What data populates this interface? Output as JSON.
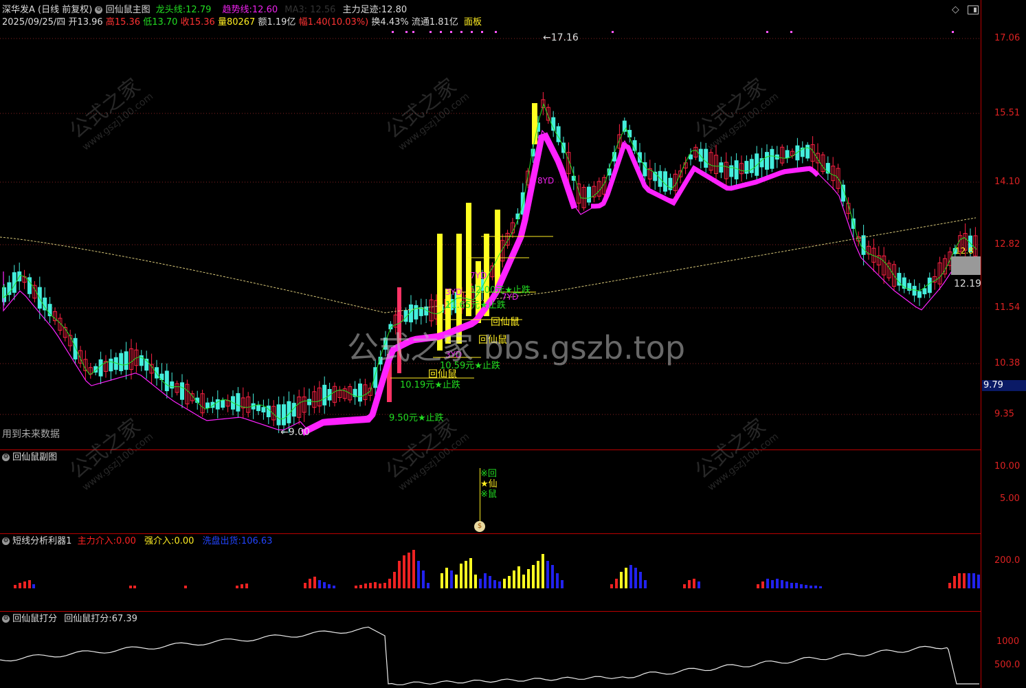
{
  "main": {
    "stock_name": "深华发A",
    "period": "(日线 前复权)",
    "indicator_name": "回仙鼠主图",
    "dragon_line_label": "龙头线:",
    "dragon_line_value": "12.79",
    "trend_line_label": "趋势线:",
    "trend_line_value": "12.60",
    "hidden_item": "MA3: 12.56",
    "footprint_label": "主力足迹:",
    "footprint_value": "12.80",
    "date": "2025/09/25/四",
    "open_label": "开",
    "open_value": "13.96",
    "high_label": "高",
    "high_value": "15.36",
    "low_label": "低",
    "low_value": "13.70",
    "close_label": "收",
    "close_value": "15.36",
    "vol_label": "量",
    "vol_value": "80267",
    "amt_label": "额",
    "amt_value": "1.19亿",
    "change_label": "幅",
    "change_value": "1.40(10.03%)",
    "turnover_label": "换",
    "turnover_value": "4.43%",
    "float_label": "流通",
    "float_value": "1.81亿",
    "board_label": "面板",
    "future_data": "用到未来数据",
    "axis": [
      "17.06",
      "15.51",
      "14.10",
      "12.82",
      "11.54",
      "10.38",
      "9.35"
    ],
    "price_tag": "9.79",
    "high_mark": "17.16",
    "low_mark": "9.00",
    "last_mark": "12.19",
    "right_mark": "12.8",
    "annotations": [
      {
        "text": "9.50元★止跌",
        "color": "#22dd22"
      },
      {
        "text": "10.19元★止跌",
        "color": "#22dd22"
      },
      {
        "text": "回仙鼠",
        "color": "#ffee22"
      },
      {
        "text": "10.59元★止跌",
        "color": "#22dd22"
      },
      {
        "text": "回仙鼠",
        "color": "#ffee22"
      },
      {
        "text": "11.65元★止跌",
        "color": "#22dd22"
      },
      {
        "text": "回仙鼠",
        "color": "#ffee22"
      },
      {
        "text": "12.00元★止跌",
        "color": "#22dd22"
      },
      {
        "text": "3YD",
        "color": "#ee22ee"
      },
      {
        "text": "3YD",
        "color": "#ee22ee"
      },
      {
        "text": "7YD",
        "color": "#ee22ee"
      },
      {
        "text": "7YD",
        "color": "#ee22ee"
      },
      {
        "text": "8YD",
        "color": "#ee22ee"
      }
    ]
  },
  "sub1": {
    "title": "回仙鼠副图",
    "axis": [
      "10.00",
      "5.00"
    ],
    "signal_chars": [
      "※回",
      "★仙",
      "※鼠"
    ]
  },
  "sub2": {
    "title": "短线分析利器1",
    "main_in_label": "主力介入:",
    "main_in_value": "0.00",
    "strong_in_label": "强介入:",
    "strong_in_value": "0.00",
    "exit_label": "洗盘出货:",
    "exit_value": "106.63",
    "axis": [
      "200.0"
    ]
  },
  "sub3": {
    "title": "回仙鼠打分",
    "score_label": "回仙鼠打分:",
    "score_value": "67.39",
    "axis": [
      "1000",
      "500.0"
    ]
  },
  "watermark": {
    "text": "公式之家",
    "url": "www.gszj100.com",
    "center": "公式之家 bbs.gszb.top"
  },
  "colors": {
    "up": "#ff2244",
    "down": "#44eedd",
    "trend": "#ff22ff",
    "dragon": "#22dd22",
    "signal": "#ffff22",
    "border": "#bb0000",
    "axis": "#dd2222",
    "blue_bar": "#2222ee"
  }
}
